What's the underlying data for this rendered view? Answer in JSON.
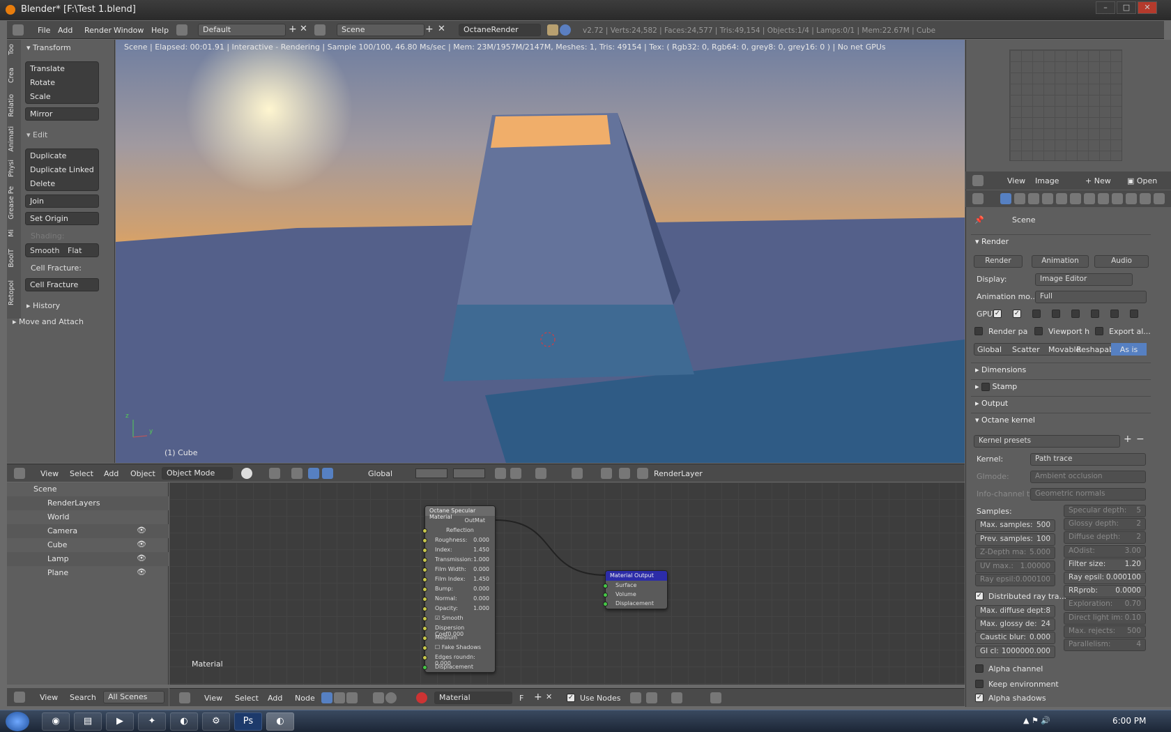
{
  "window": {
    "title": "Blender* [F:\\Test 1.blend]"
  },
  "menubar": {
    "items": [
      "File",
      "Add",
      "Render",
      "Window",
      "Help"
    ],
    "layout": "Default",
    "scene": "Scene",
    "engine": "OctaneRender",
    "stats": "v2.72 | Verts:24,582 | Faces:24,577 | Tris:49,154 | Objects:1/4 | Lamps:0/1 | Mem:22.67M | Cube"
  },
  "toolshelf": {
    "tabs": [
      "Too",
      "Crea",
      "Relatio",
      "Animati",
      "Physi",
      "Grease Pe",
      "Mi",
      "BoolT",
      "Retopol"
    ],
    "transform_header": "Transform",
    "translate": "Translate",
    "rotate": "Rotate",
    "scale": "Scale",
    "mirror": "Mirror",
    "edit_header": "Edit",
    "duplicate": "Duplicate",
    "duplicate_linked": "Duplicate Linked",
    "delete": "Delete",
    "join": "Join",
    "set_origin": "Set Origin",
    "shading_header": "Shading:",
    "smooth": "Smooth",
    "flat": "Flat",
    "cell_fracture_label": "Cell Fracture:",
    "cell_fracture": "Cell Fracture",
    "history": "History",
    "move_attach": "Move and Attach"
  },
  "viewport": {
    "status": "Scene | Elapsed: 00:01.91 | Interactive - Rendering | Sample 100/100, 46.80 Ms/sec | Mem: 23M/1957M/2147M, Meshes: 1, Tris: 49154 | Tex: ( Rgb32: 0, Rgb64: 0, grey8: 0, grey16: 0 ) | No net GPUs",
    "object": "(1) Cube",
    "axis_z": "z",
    "axis_y": "y"
  },
  "view_header": {
    "view": "View",
    "select": "Select",
    "add": "Add",
    "object": "Object",
    "mode": "Object Mode",
    "orientation": "Global",
    "render_layer": "RenderLayer"
  },
  "outliner": {
    "rows": [
      {
        "name": "Scene"
      },
      {
        "name": "RenderLayers"
      },
      {
        "name": "World"
      },
      {
        "name": "Camera"
      },
      {
        "name": "Cube"
      },
      {
        "name": "Lamp"
      },
      {
        "name": "Plane"
      }
    ],
    "footer": {
      "view": "View",
      "search": "Search",
      "all_scenes": "All Scenes"
    }
  },
  "node_editor": {
    "label": "Material",
    "spec_node": {
      "title": "Octane Specular Material",
      "out": "OutMat",
      "reflection": "Reflection",
      "fields": [
        {
          "k": "Roughness:",
          "v": "0.000"
        },
        {
          "k": "Index:",
          "v": "1.450"
        },
        {
          "k": "Transmission:",
          "v": "1.000"
        },
        {
          "k": "Film Width:",
          "v": "0.000"
        },
        {
          "k": "Film Index:",
          "v": "1.450"
        },
        {
          "k": "Bump:",
          "v": "0.000"
        },
        {
          "k": "Normal:",
          "v": "0.000"
        },
        {
          "k": "Opacity:",
          "v": "1.000"
        }
      ],
      "smooth": "Smooth",
      "dispersion": "Dispersion Coef0.000",
      "medium": "Medium",
      "fake_shadows": "Fake Shadows",
      "edges": "Edges roundn: 0.000",
      "displacement": "Displacement"
    },
    "output_node": {
      "title": "Material Output",
      "surface": "Surface",
      "volume": "Volume",
      "displacement": "Displacement"
    },
    "footer": {
      "view": "View",
      "select": "Select",
      "add": "Add",
      "node": "Node",
      "material": "Material",
      "f": "F",
      "use_nodes": "Use Nodes"
    }
  },
  "image_editor": {
    "view": "View",
    "image": "Image",
    "new": "New",
    "open": "Open"
  },
  "properties": {
    "scene": "Scene",
    "render_section": "Render",
    "render_btn": "Render",
    "animation_btn": "Animation",
    "audio_btn": "Audio",
    "display_label": "Display:",
    "display_val": "Image Editor",
    "anim_label": "Animation mo...",
    "anim_val": "Full",
    "gpu": "GPU",
    "render_pa": "Render pa",
    "viewport_h": "Viewport h",
    "export_al": "Export al...",
    "tabs": [
      "Global",
      "Scatter",
      "Movable",
      "Reshapab",
      "As is"
    ],
    "dimensions": "Dimensions",
    "stamp": "Stamp",
    "output": "Output",
    "octane_kernel": "Octane kernel",
    "kernel_presets": "Kernel presets",
    "kernel_label": "Kernel:",
    "kernel_val": "Path trace",
    "gimode_label": "GImode:",
    "gimode_val": "Ambient occlusion",
    "info_label": "Info-channel t...",
    "info_val": "Geometric normals",
    "samples": "Samples:",
    "left": [
      {
        "t": "Max. samples:",
        "v": "500",
        "d": false
      },
      {
        "t": "Prev. samples:",
        "v": "100",
        "d": false
      },
      {
        "t": "Z-Depth ma:",
        "v": "5.000",
        "d": true
      },
      {
        "t": "UV max.:",
        "v": "1.00000",
        "d": true
      },
      {
        "t": "Ray epsil:",
        "v": "0.000100",
        "d": true
      }
    ],
    "right": [
      {
        "t": "Specular depth:",
        "v": "5",
        "d": true
      },
      {
        "t": "Glossy depth:",
        "v": "2",
        "d": true
      },
      {
        "t": "Diffuse depth:",
        "v": "2",
        "d": true
      },
      {
        "t": "AOdist:",
        "v": "3.00",
        "d": true
      },
      {
        "t": "Filter size:",
        "v": "1.20",
        "d": false
      },
      {
        "t": "Ray epsil:",
        "v": "0.000100",
        "d": false
      },
      {
        "t": "RRprob:",
        "v": "0.0000",
        "d": false
      },
      {
        "t": "Exploration:",
        "v": "0.70",
        "d": true
      },
      {
        "t": "Direct light im:",
        "v": "0.10",
        "d": true
      },
      {
        "t": "Max. rejects:",
        "v": "500",
        "d": true
      },
      {
        "t": "Parallelism:",
        "v": "4",
        "d": true
      }
    ],
    "distributed": "Distributed ray tra...",
    "left2": [
      {
        "t": "Max. diffuse dept:",
        "v": "8"
      },
      {
        "t": "Max. glossy de:",
        "v": "24"
      },
      {
        "t": "Caustic blur:",
        "v": "0.000"
      },
      {
        "t": "GI cl:",
        "v": "1000000.000"
      }
    ],
    "alpha_channel": "Alpha channel",
    "keep_env": "Keep environment",
    "alpha_shadows": "Alpha shadows"
  },
  "taskbar": {
    "clock": "6:00 PM"
  }
}
